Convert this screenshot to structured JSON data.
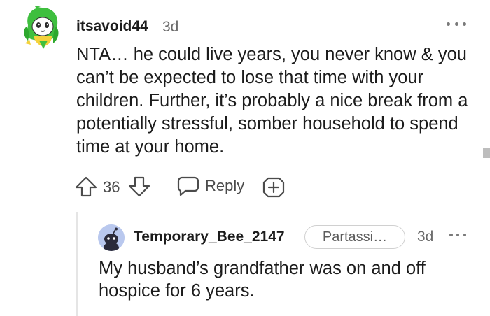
{
  "comment": {
    "username": "itsavoid44",
    "age": "3d",
    "body": "NTA… he could live years, you never know & you can’t be expected to lose that time with your children. Further, it’s probably a nice break from a potentially stressful, somber household to spend time at your home.",
    "vote_count": "36",
    "reply_label": "Reply",
    "icons": {
      "avatar": "cartoon-avatar-icon",
      "upvote": "arrow-up-icon",
      "downvote": "arrow-down-icon",
      "reply": "speech-bubble-icon",
      "award": "award-plus-icon",
      "more": "more-options-icon"
    }
  },
  "reply": {
    "username": "Temporary_Bee_2147",
    "flair": "Partassi…",
    "age": "3d",
    "body": "My husband’s grandfather was on and off hospice for 6 years.",
    "icons": {
      "avatar": "default-snoo-avatar-icon",
      "more": "more-options-icon"
    }
  },
  "colors": {
    "text": "#1c1c1c",
    "muted": "#6a6a6a",
    "action": "#4b4b4b",
    "reply_avatar_bg": "#b9c8ee"
  }
}
